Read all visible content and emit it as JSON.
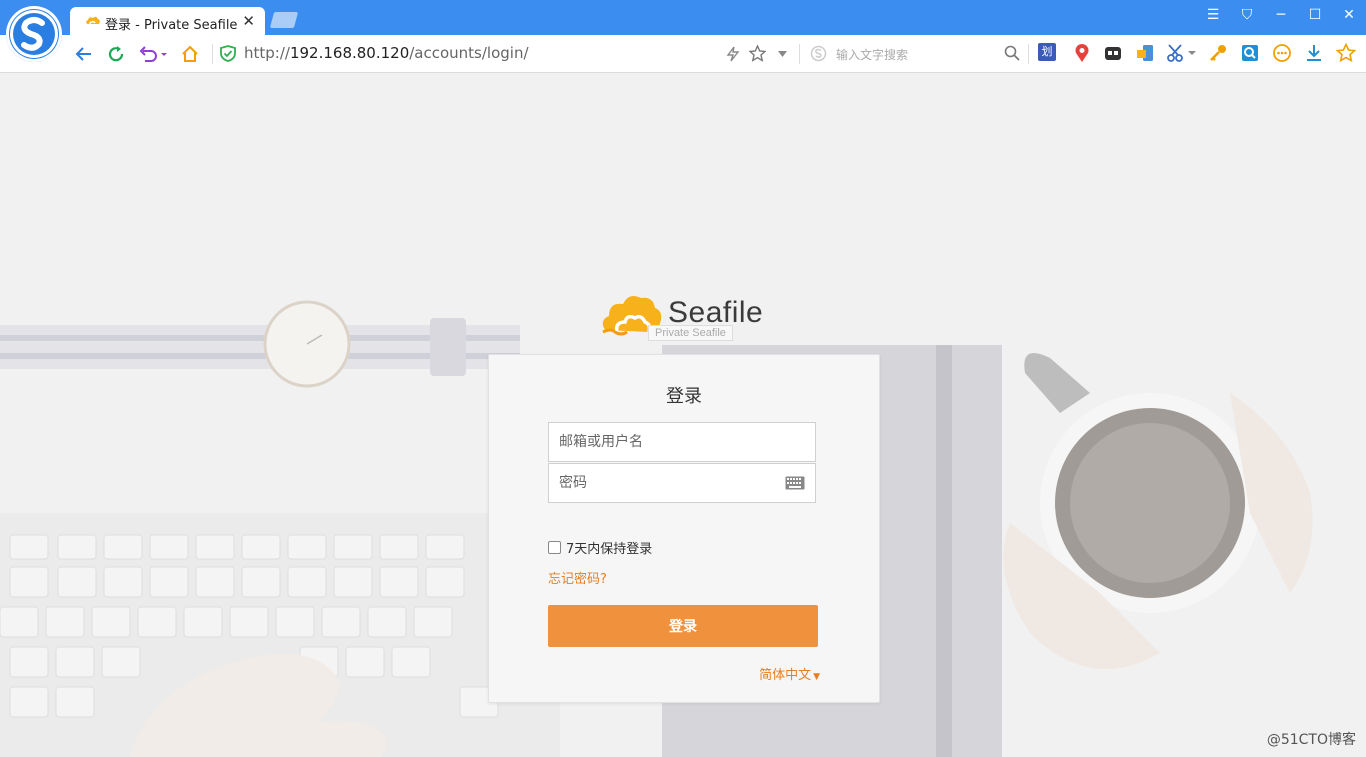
{
  "browser": {
    "tab_title": "登录 - Private Seafile",
    "tab_close": "✕",
    "url_scheme": "http://",
    "url_host": "192.168.80.120",
    "url_path": "/accounts/login/",
    "search_placeholder": "输入文字搜索",
    "ext_badge": "划",
    "window_controls": [
      "☰",
      "⛉",
      "─",
      "☐",
      "✕"
    ]
  },
  "logo": {
    "text": "Seafile",
    "tooltip": "Private Seafile"
  },
  "login": {
    "title": "登录",
    "username_placeholder": "邮箱或用户名",
    "password_placeholder": "密码",
    "remember_label": "7天内保持登录",
    "forgot_link": "忘记密码?",
    "submit_label": "登录",
    "language": "简体中文"
  },
  "watermark": "@51CTO博客",
  "colors": {
    "browser_blue": "#3b8ef0",
    "accent_orange": "#f0923d",
    "link_orange": "#e67e22"
  }
}
